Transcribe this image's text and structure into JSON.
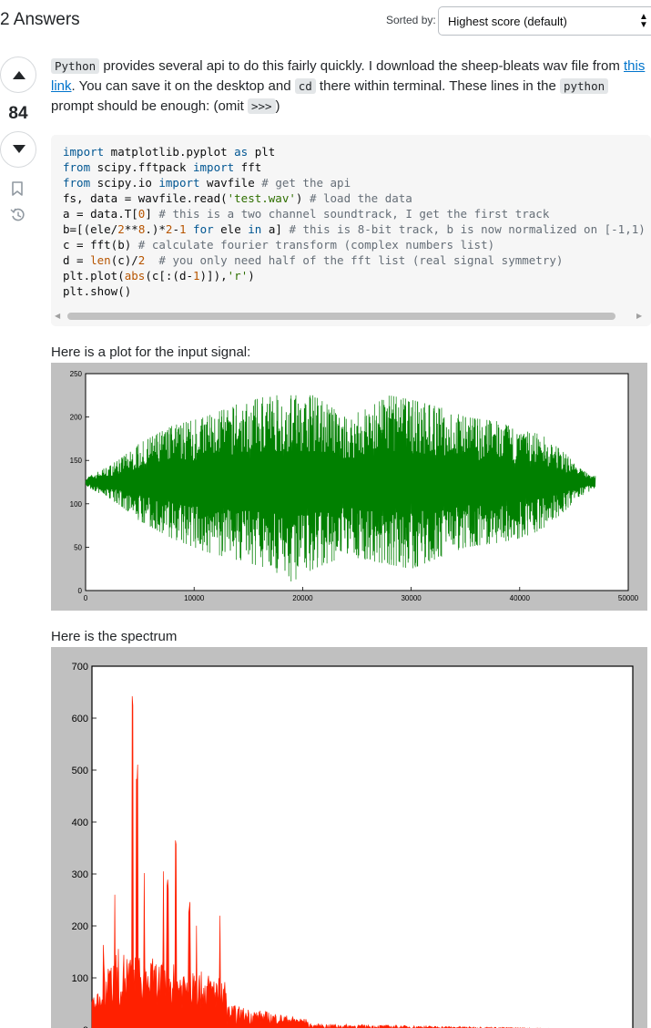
{
  "header": {
    "answers_count_title": "2 Answers",
    "sort_label": "Sorted by:",
    "sort_value": "Highest score (default)"
  },
  "answer": {
    "score": "84",
    "icons": [
      "upvote-icon",
      "downvote-icon",
      "bookmark-icon",
      "history-icon"
    ],
    "paragraph": {
      "code1": "Python",
      "t1": " provides several api to do this fairly quickly. I download the sheep-bleats wav file from ",
      "link": "this link",
      "t2": ". You can save it on the desktop and ",
      "code2": "cd",
      "t3": " there within terminal. These lines in the ",
      "code3": "python",
      "t4": " prompt should be enough: (omit ",
      "code4": ">>>",
      "t5": ")"
    },
    "code_lines": [
      "import matplotlib.pyplot as plt",
      "from scipy.fftpack import fft",
      "from scipy.io import wavfile # get the api",
      "fs, data = wavfile.read('test.wav') # load the data",
      "a = data.T[0] # this is a two channel soundtrack, I get the first track",
      "b=[(ele/2**8.)*2-1 for ele in a] # this is 8-bit track, b is now normalized on [-1,1)",
      "c = fft(b) # calculate fourier transform (complex numbers list)",
      "d = len(c)/2  # you only need half of the fft list (real signal symmetry)",
      "plt.plot(abs(c[:(d-1)]),'r')",
      "plt.show()"
    ],
    "caption1": "Here is a plot for the input signal:",
    "caption2": "Here is the spectrum"
  },
  "colors": {
    "signal": "#008000",
    "spectrum": "#ff2000",
    "link": "#0074cc",
    "code_bg": "#f6f6f6",
    "plot_bg": "#c0c0c0"
  },
  "chart_data": [
    {
      "type": "line",
      "x_ticks": [
        "0",
        "10000",
        "20000",
        "30000",
        "40000",
        "50000"
      ],
      "y_ticks": [
        "0",
        "50",
        "100",
        "150",
        "200",
        "250"
      ],
      "xlim": [
        0,
        50000
      ],
      "ylim": [
        0,
        250
      ],
      "x_end": 47000,
      "baseline": 125,
      "envelope": [
        {
          "x": 0,
          "y": [
            120,
            130
          ]
        },
        {
          "x": 1500,
          "y": [
            110,
            140
          ]
        },
        {
          "x": 3000,
          "y": [
            100,
            150
          ]
        },
        {
          "x": 5000,
          "y": [
            80,
            170
          ]
        },
        {
          "x": 8000,
          "y": [
            60,
            190
          ]
        },
        {
          "x": 11000,
          "y": [
            45,
            200
          ]
        },
        {
          "x": 14000,
          "y": [
            35,
            215
          ]
        },
        {
          "x": 17000,
          "y": [
            25,
            225
          ]
        },
        {
          "x": 19000,
          "y": [
            10,
            225
          ]
        },
        {
          "x": 21000,
          "y": [
            25,
            225
          ]
        },
        {
          "x": 24000,
          "y": [
            40,
            200
          ]
        },
        {
          "x": 26000,
          "y": [
            35,
            210
          ]
        },
        {
          "x": 28000,
          "y": [
            30,
            225
          ]
        },
        {
          "x": 30000,
          "y": [
            25,
            220
          ]
        },
        {
          "x": 33000,
          "y": [
            40,
            210
          ]
        },
        {
          "x": 35000,
          "y": [
            50,
            200
          ]
        },
        {
          "x": 38000,
          "y": [
            55,
            195
          ]
        },
        {
          "x": 40000,
          "y": [
            60,
            185
          ]
        },
        {
          "x": 42000,
          "y": [
            70,
            180
          ]
        },
        {
          "x": 44000,
          "y": [
            90,
            160
          ]
        },
        {
          "x": 45500,
          "y": [
            108,
            142
          ]
        },
        {
          "x": 47000,
          "y": [
            118,
            132
          ]
        }
      ]
    },
    {
      "type": "line",
      "y_ticks": [
        "0",
        "100",
        "200",
        "300",
        "400",
        "500",
        "600",
        "700"
      ],
      "ylim": [
        0,
        700
      ],
      "peaks": [
        {
          "x_frac": 0.075,
          "y": 660
        },
        {
          "x_frac": 0.083,
          "y": 530
        },
        {
          "x_frac": 0.155,
          "y": 395
        },
        {
          "x_frac": 0.14,
          "y": 300
        },
        {
          "x_frac": 0.18,
          "y": 250
        }
      ]
    }
  ]
}
